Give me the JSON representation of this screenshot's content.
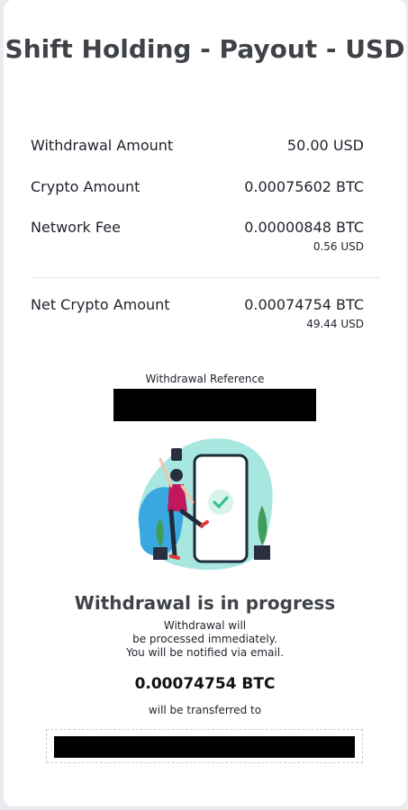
{
  "page": {
    "title": "Shift Holding - Payout - USD"
  },
  "summary": {
    "withdrawal_amount": {
      "label": "Withdrawal Amount",
      "value": "50.00 USD"
    },
    "crypto_amount": {
      "label": "Crypto Amount",
      "value": "0.00075602 BTC"
    },
    "network_fee": {
      "label": "Network Fee",
      "value": "0.00000848 BTC",
      "sub_value": "0.56 USD"
    },
    "net_crypto_amount": {
      "label": "Net Crypto Amount",
      "value": "0.00074754 BTC",
      "sub_value": "49.44 USD"
    }
  },
  "reference": {
    "label": "Withdrawal Reference"
  },
  "status": {
    "title": "Withdrawal is in progress",
    "line1": "Withdrawal will",
    "line2": "be processed immediately.",
    "line3": "You will be notified via email.",
    "btc_amount": "0.00074754 BTC",
    "transfer_label": "will be transferred to"
  },
  "colors": {
    "title_text": "#3f4348",
    "accent_teal": "#5fd3c6",
    "accent_blue": "#3aa8e0",
    "check_green": "#2bbf8a",
    "redaction": "#000000"
  },
  "icons": {
    "illustration": "success-illustration",
    "check": "check-icon"
  }
}
